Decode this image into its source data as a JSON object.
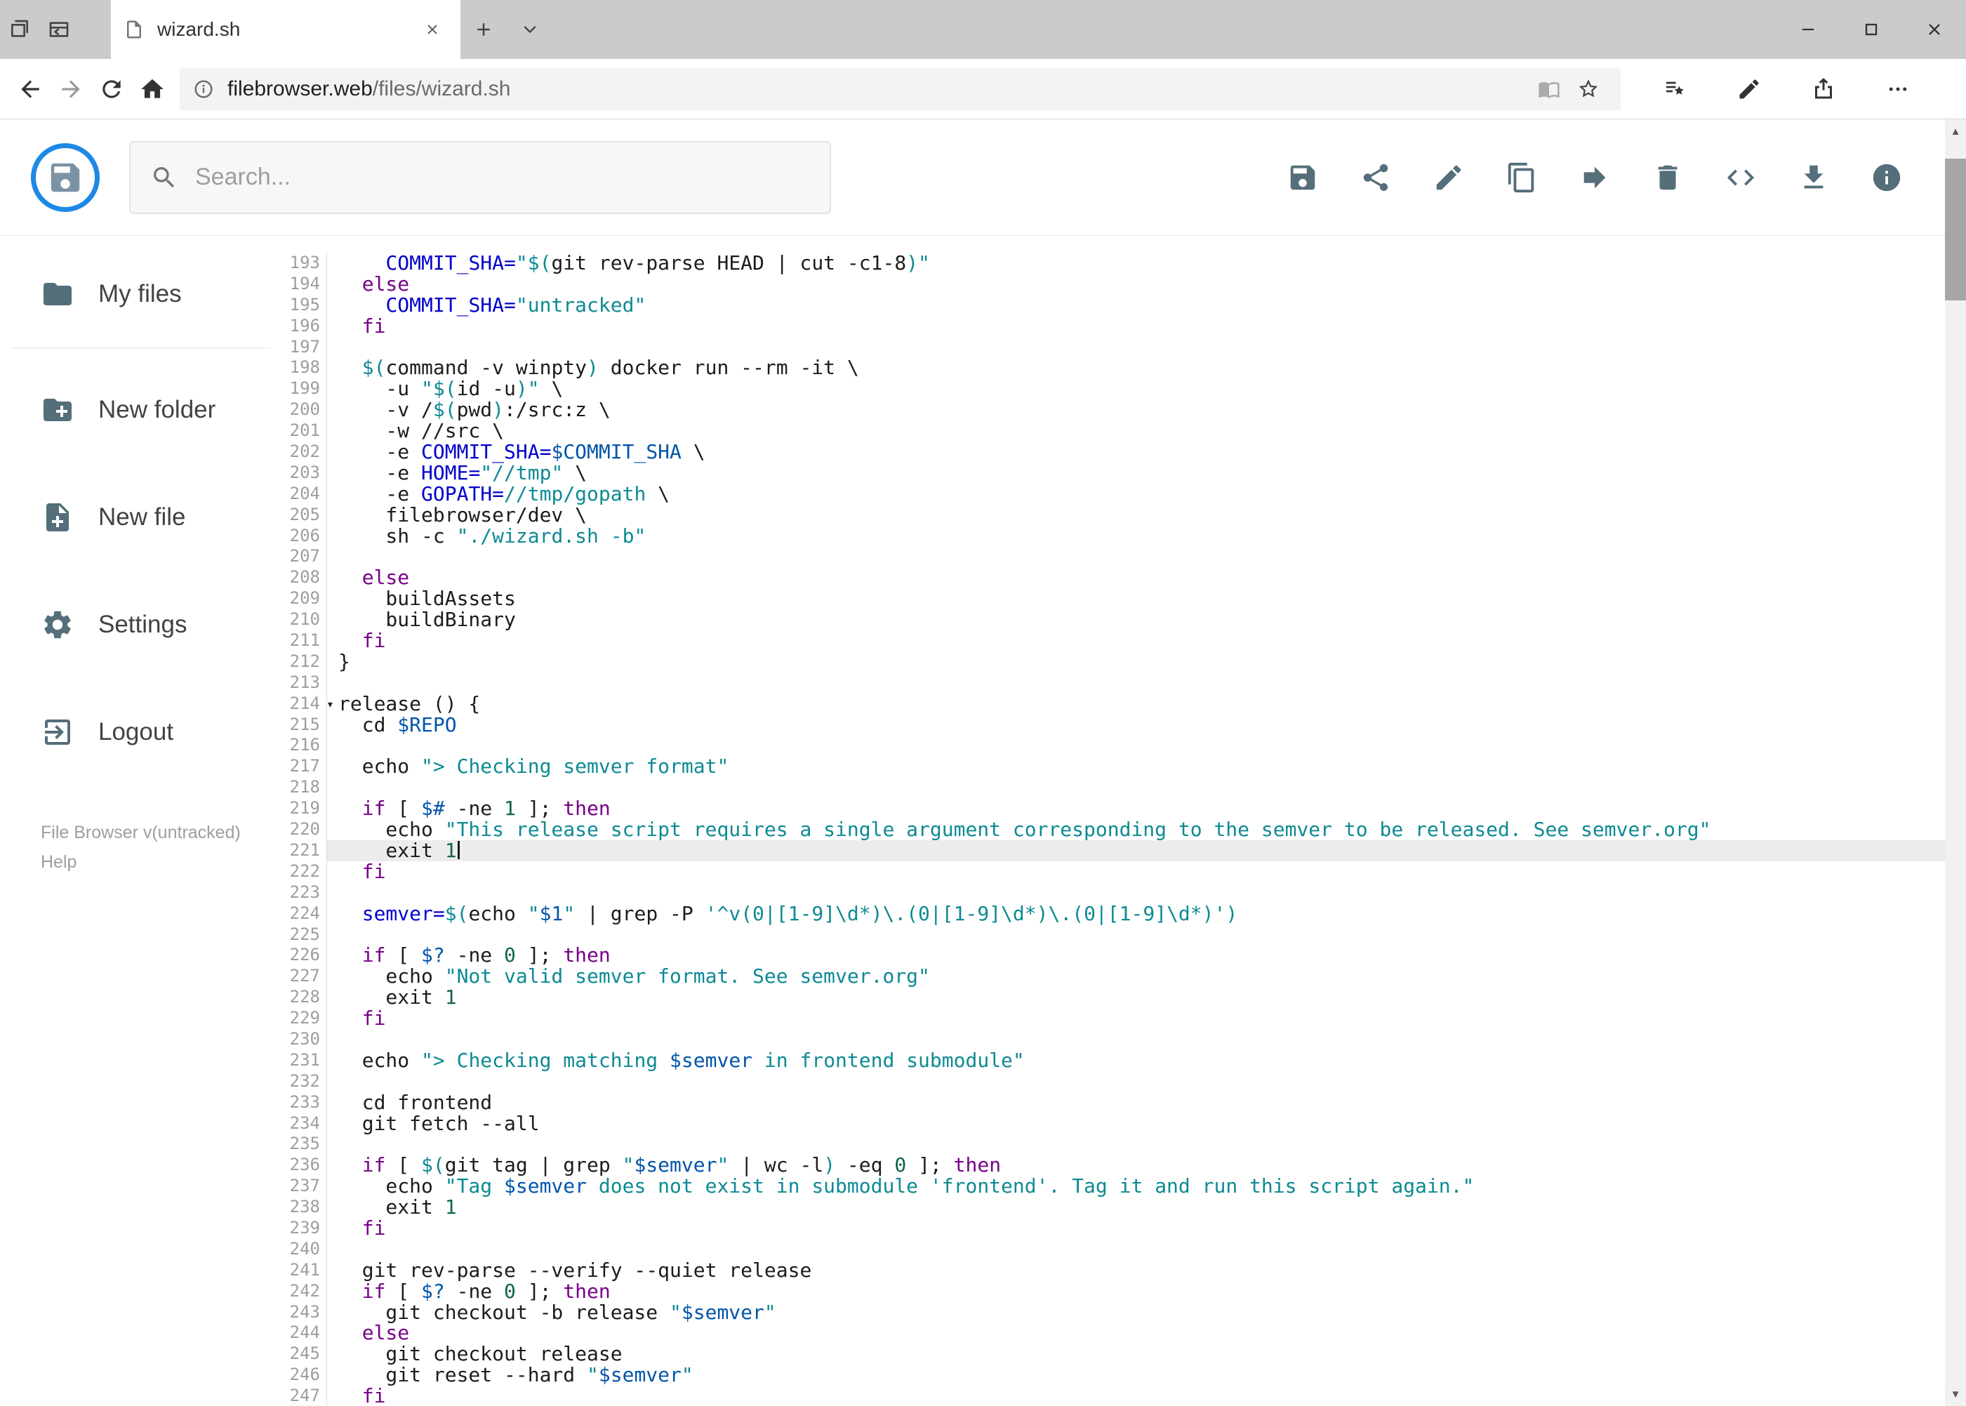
{
  "browser": {
    "tab_title": "wizard.sh",
    "url_domain": "filebrowser.web",
    "url_path": "/files/wizard.sh",
    "nav_icons": [
      "back",
      "forward",
      "refresh",
      "home"
    ],
    "address_icons": [
      "info",
      "reading-view",
      "favorite-star"
    ],
    "toolbar_icons": [
      "favorites-hub",
      "web-note",
      "share",
      "more"
    ],
    "window_buttons": [
      "minimize",
      "maximize",
      "close"
    ]
  },
  "app": {
    "search_placeholder": "Search...",
    "action_icons": [
      "save",
      "share",
      "edit",
      "copy",
      "move",
      "delete",
      "code",
      "download",
      "info"
    ]
  },
  "sidebar": {
    "items": [
      {
        "label": "My files",
        "icon": "folder"
      },
      {
        "label": "New folder",
        "icon": "create-new-folder"
      },
      {
        "label": "New file",
        "icon": "new-file"
      },
      {
        "label": "Settings",
        "icon": "settings-gear"
      },
      {
        "label": "Logout",
        "icon": "logout"
      }
    ],
    "footer_version": "File Browser v(untracked)",
    "footer_help": "Help"
  },
  "colors": {
    "accent_blue": "#1e88e5",
    "icon_gray": "#546e7a",
    "active_line_bg": "#ececec",
    "code_keyword": "#770088",
    "code_string": "#0d8a93",
    "code_variable": "#0055aa",
    "code_def": "#0000cc",
    "code_number": "#116644"
  },
  "editor": {
    "first_line": 193,
    "last_line": 247,
    "active_line": 221,
    "cursor_line": 221,
    "fold_line": 214,
    "lines": [
      {
        "n": 193,
        "t": [
          [
            "    ",
            "p"
          ],
          [
            "COMMIT_SHA=",
            "d"
          ],
          [
            "\"$(",
            "s"
          ],
          [
            "git rev-parse HEAD | cut -c1-8",
            "p"
          ],
          [
            ")\"",
            "s"
          ]
        ]
      },
      {
        "n": 194,
        "t": [
          [
            "  ",
            "p"
          ],
          [
            "else",
            "k"
          ]
        ]
      },
      {
        "n": 195,
        "t": [
          [
            "    ",
            "p"
          ],
          [
            "COMMIT_SHA=",
            "d"
          ],
          [
            "\"untracked\"",
            "s"
          ]
        ]
      },
      {
        "n": 196,
        "t": [
          [
            "  ",
            "p"
          ],
          [
            "fi",
            "k"
          ]
        ]
      },
      {
        "n": 197,
        "t": []
      },
      {
        "n": 198,
        "t": [
          [
            "  ",
            "p"
          ],
          [
            "$(",
            "s"
          ],
          [
            "command -v winpty",
            "p"
          ],
          [
            ")",
            "s"
          ],
          [
            " docker run --rm -it \\",
            "p"
          ]
        ]
      },
      {
        "n": 199,
        "t": [
          [
            "    -u ",
            "p"
          ],
          [
            "\"$(",
            "s"
          ],
          [
            "id -u",
            "p"
          ],
          [
            ")\"",
            "s"
          ],
          [
            " \\",
            "p"
          ]
        ]
      },
      {
        "n": 200,
        "t": [
          [
            "    -v /",
            "p"
          ],
          [
            "$(",
            "s"
          ],
          [
            "pwd",
            "p"
          ],
          [
            ")",
            "s"
          ],
          [
            ":/src:z \\",
            "p"
          ]
        ]
      },
      {
        "n": 201,
        "t": [
          [
            "    -w //src \\",
            "p"
          ]
        ]
      },
      {
        "n": 202,
        "t": [
          [
            "    -e ",
            "p"
          ],
          [
            "COMMIT_SHA=",
            "d"
          ],
          [
            "$COMMIT_SHA",
            "v"
          ],
          [
            " \\",
            "p"
          ]
        ]
      },
      {
        "n": 203,
        "t": [
          [
            "    -e ",
            "p"
          ],
          [
            "HOME=",
            "d"
          ],
          [
            "\"//tmp\"",
            "s"
          ],
          [
            " \\",
            "p"
          ]
        ]
      },
      {
        "n": 204,
        "t": [
          [
            "    -e ",
            "p"
          ],
          [
            "GOPATH=",
            "d"
          ],
          [
            "//tmp/gopath",
            "s"
          ],
          [
            " \\",
            "p"
          ]
        ]
      },
      {
        "n": 205,
        "t": [
          [
            "    filebrowser/dev \\",
            "p"
          ]
        ]
      },
      {
        "n": 206,
        "t": [
          [
            "    sh -c ",
            "p"
          ],
          [
            "\"./wizard.sh -b\"",
            "s"
          ]
        ]
      },
      {
        "n": 207,
        "t": []
      },
      {
        "n": 208,
        "t": [
          [
            "  ",
            "p"
          ],
          [
            "else",
            "k"
          ]
        ]
      },
      {
        "n": 209,
        "t": [
          [
            "    buildAssets",
            "p"
          ]
        ]
      },
      {
        "n": 210,
        "t": [
          [
            "    buildBinary",
            "p"
          ]
        ]
      },
      {
        "n": 211,
        "t": [
          [
            "  ",
            "p"
          ],
          [
            "fi",
            "k"
          ]
        ]
      },
      {
        "n": 212,
        "t": [
          [
            "}",
            "p"
          ]
        ]
      },
      {
        "n": 213,
        "t": []
      },
      {
        "n": 214,
        "t": [
          [
            "release () {",
            "p"
          ]
        ]
      },
      {
        "n": 215,
        "t": [
          [
            "  cd ",
            "p"
          ],
          [
            "$REPO",
            "v"
          ]
        ]
      },
      {
        "n": 216,
        "t": []
      },
      {
        "n": 217,
        "t": [
          [
            "  echo ",
            "p"
          ],
          [
            "\"> Checking semver format\"",
            "s"
          ]
        ]
      },
      {
        "n": 218,
        "t": []
      },
      {
        "n": 219,
        "t": [
          [
            "  ",
            "p"
          ],
          [
            "if",
            "k"
          ],
          [
            " [ ",
            "p"
          ],
          [
            "$#",
            "v"
          ],
          [
            " -ne ",
            "p"
          ],
          [
            "1",
            "n"
          ],
          [
            " ]; ",
            "p"
          ],
          [
            "then",
            "k"
          ]
        ]
      },
      {
        "n": 220,
        "t": [
          [
            "    echo ",
            "p"
          ],
          [
            "\"This release script requires a single argument corresponding to the semver to be released. See semver.org\"",
            "s"
          ]
        ]
      },
      {
        "n": 221,
        "t": [
          [
            "    exit ",
            "p"
          ],
          [
            "1",
            "n"
          ]
        ]
      },
      {
        "n": 222,
        "t": [
          [
            "  ",
            "p"
          ],
          [
            "fi",
            "k"
          ]
        ]
      },
      {
        "n": 223,
        "t": []
      },
      {
        "n": 224,
        "t": [
          [
            "  ",
            "p"
          ],
          [
            "semver=",
            "d"
          ],
          [
            "$(",
            "s"
          ],
          [
            "echo ",
            "p"
          ],
          [
            "\"",
            "s"
          ],
          [
            "$1",
            "v"
          ],
          [
            "\"",
            "s"
          ],
          [
            " | grep -P ",
            "p"
          ],
          [
            "'^v(0|[1-9]\\d*)\\.(0|[1-9]\\d*)\\.(0|[1-9]\\d*)'",
            "s"
          ],
          [
            ")",
            "s"
          ]
        ]
      },
      {
        "n": 225,
        "t": []
      },
      {
        "n": 226,
        "t": [
          [
            "  ",
            "p"
          ],
          [
            "if",
            "k"
          ],
          [
            " [ ",
            "p"
          ],
          [
            "$?",
            "v"
          ],
          [
            " -ne ",
            "p"
          ],
          [
            "0",
            "n"
          ],
          [
            " ]; ",
            "p"
          ],
          [
            "then",
            "k"
          ]
        ]
      },
      {
        "n": 227,
        "t": [
          [
            "    echo ",
            "p"
          ],
          [
            "\"Not valid semver format. See semver.org\"",
            "s"
          ]
        ]
      },
      {
        "n": 228,
        "t": [
          [
            "    exit ",
            "p"
          ],
          [
            "1",
            "n"
          ]
        ]
      },
      {
        "n": 229,
        "t": [
          [
            "  ",
            "p"
          ],
          [
            "fi",
            "k"
          ]
        ]
      },
      {
        "n": 230,
        "t": []
      },
      {
        "n": 231,
        "t": [
          [
            "  echo ",
            "p"
          ],
          [
            "\"> Checking matching ",
            "s"
          ],
          [
            "$semver",
            "v"
          ],
          [
            " in frontend submodule\"",
            "s"
          ]
        ]
      },
      {
        "n": 232,
        "t": []
      },
      {
        "n": 233,
        "t": [
          [
            "  cd frontend",
            "p"
          ]
        ]
      },
      {
        "n": 234,
        "t": [
          [
            "  git fetch --all",
            "p"
          ]
        ]
      },
      {
        "n": 235,
        "t": []
      },
      {
        "n": 236,
        "t": [
          [
            "  ",
            "p"
          ],
          [
            "if",
            "k"
          ],
          [
            " [ ",
            "p"
          ],
          [
            "$(",
            "s"
          ],
          [
            "git tag | grep ",
            "p"
          ],
          [
            "\"",
            "s"
          ],
          [
            "$semver",
            "v"
          ],
          [
            "\"",
            "s"
          ],
          [
            " | wc -l",
            "p"
          ],
          [
            ")",
            "s"
          ],
          [
            " -eq ",
            "p"
          ],
          [
            "0",
            "n"
          ],
          [
            " ]; ",
            "p"
          ],
          [
            "then",
            "k"
          ]
        ]
      },
      {
        "n": 237,
        "t": [
          [
            "    echo ",
            "p"
          ],
          [
            "\"Tag ",
            "s"
          ],
          [
            "$semver",
            "v"
          ],
          [
            " does not exist in submodule 'frontend'. Tag it and run this script again.\"",
            "s"
          ]
        ]
      },
      {
        "n": 238,
        "t": [
          [
            "    exit ",
            "p"
          ],
          [
            "1",
            "n"
          ]
        ]
      },
      {
        "n": 239,
        "t": [
          [
            "  ",
            "p"
          ],
          [
            "fi",
            "k"
          ]
        ]
      },
      {
        "n": 240,
        "t": []
      },
      {
        "n": 241,
        "t": [
          [
            "  git rev-parse --verify --quiet release",
            "p"
          ]
        ]
      },
      {
        "n": 242,
        "t": [
          [
            "  ",
            "p"
          ],
          [
            "if",
            "k"
          ],
          [
            " [ ",
            "p"
          ],
          [
            "$?",
            "v"
          ],
          [
            " -ne ",
            "p"
          ],
          [
            "0",
            "n"
          ],
          [
            " ]; ",
            "p"
          ],
          [
            "then",
            "k"
          ]
        ]
      },
      {
        "n": 243,
        "t": [
          [
            "    git checkout -b release ",
            "p"
          ],
          [
            "\"",
            "s"
          ],
          [
            "$semver",
            "v"
          ],
          [
            "\"",
            "s"
          ]
        ]
      },
      {
        "n": 244,
        "t": [
          [
            "  ",
            "p"
          ],
          [
            "else",
            "k"
          ]
        ]
      },
      {
        "n": 245,
        "t": [
          [
            "    git checkout release",
            "p"
          ]
        ]
      },
      {
        "n": 246,
        "t": [
          [
            "    git reset --hard ",
            "p"
          ],
          [
            "\"",
            "s"
          ],
          [
            "$semver",
            "v"
          ],
          [
            "\"",
            "s"
          ]
        ]
      },
      {
        "n": 247,
        "t": [
          [
            "  ",
            "p"
          ],
          [
            "fi",
            "k"
          ]
        ]
      }
    ]
  }
}
